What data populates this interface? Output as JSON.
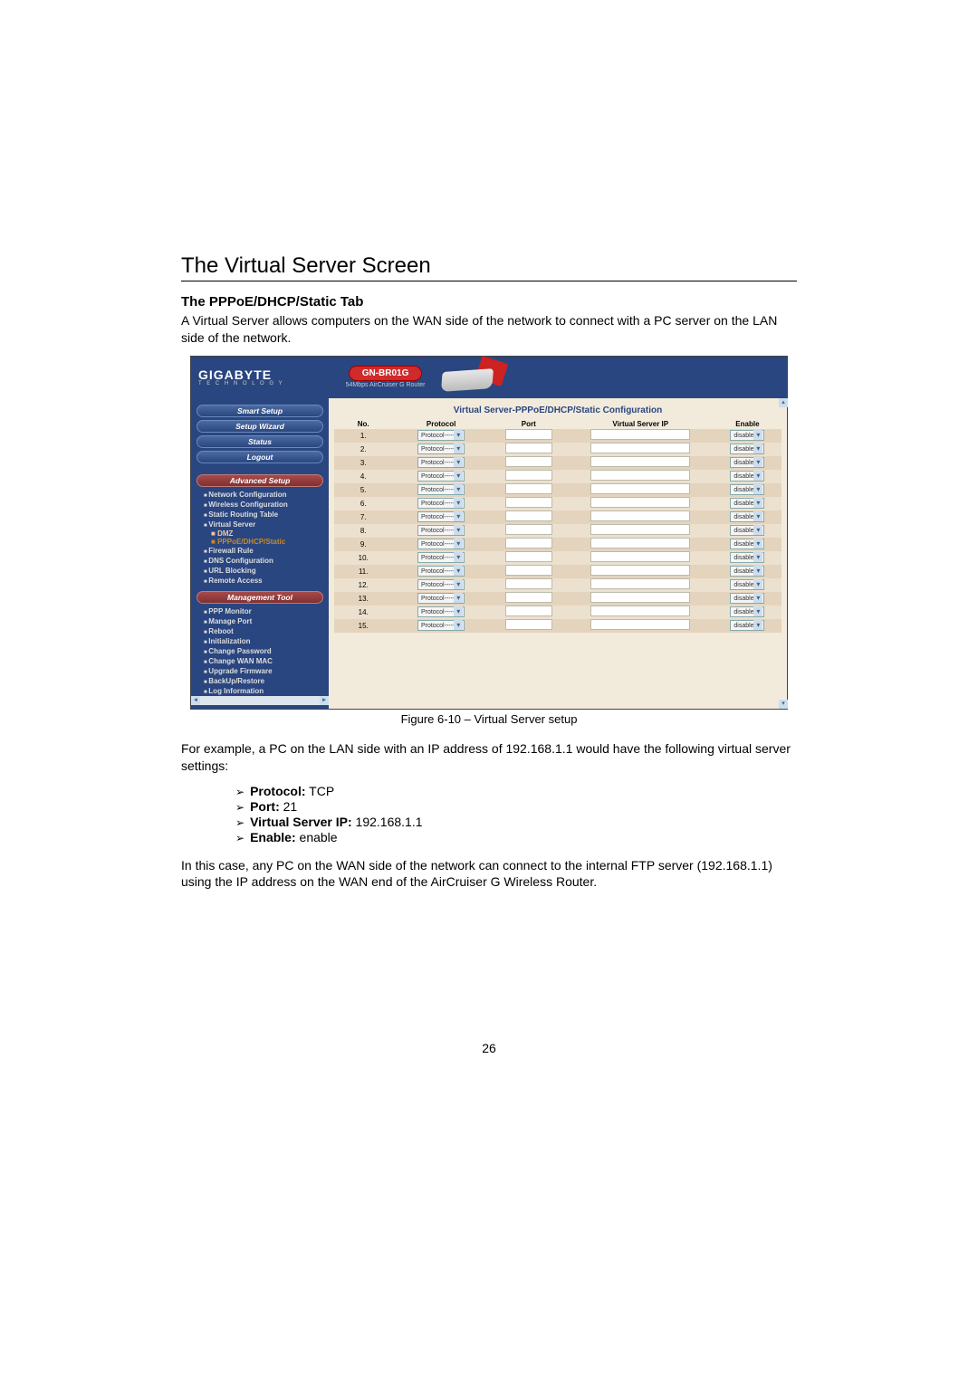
{
  "title": "The Virtual Server Screen",
  "subtitle": "The PPPoE/DHCP/Static Tab",
  "intro": "A Virtual Server allows computers on the WAN side of the network to connect with a PC server on the LAN side of the network.",
  "fig": {
    "brand": "GIGABYTE",
    "brand_sub": "T E C H N O L O G Y",
    "model": "GN-BR01G",
    "model_sub": "54Mbps AirCruiser G Router",
    "smart_setup": "Smart Setup",
    "setup_wizard": "Setup Wizard",
    "status": "Status",
    "logout": "Logout",
    "advanced_setup": "Advanced Setup",
    "nav": {
      "net_cfg": "Network Configuration",
      "wls_cfg": "Wireless Configuration",
      "static_route": "Static Routing Table",
      "vserver": "Virtual Server",
      "dmz": "DMZ",
      "ppp_static": "PPPoE/DHCP/Static",
      "firewall": "Firewall Rule",
      "dns": "DNS Configuration",
      "url_block": "URL Blocking",
      "remote": "Remote Access"
    },
    "mgmt_tool": "Management Tool",
    "mgmt": {
      "ppp_monitor": "PPP Monitor",
      "manage_port": "Manage Port",
      "reboot": "Reboot",
      "init": "Initialization",
      "change_pw": "Change Password",
      "change_mac": "Change WAN MAC",
      "upgrade": "Upgrade Firmware",
      "backup": "BackUp/Restore",
      "log": "Log Information"
    },
    "content_title": "Virtual Server-PPPoE/DHCP/Static Configuration",
    "th_no": "No.",
    "th_protocol": "Protocol",
    "th_port": "Port",
    "th_vsip": "Virtual Server IP",
    "th_enable": "Enable",
    "protocol_opt": "Protocol-----",
    "enable_opt": "disable",
    "rows": [
      "1.",
      "2.",
      "3.",
      "4.",
      "5.",
      "6.",
      "7.",
      "8.",
      "9.",
      "10.",
      "11.",
      "12.",
      "13.",
      "14.",
      "15."
    ]
  },
  "caption": "Figure 6-10 – Virtual Server setup",
  "example_intro": "For example, a PC on the LAN side with an IP address of 192.168.1.1 would have the following virtual server settings:",
  "example": {
    "protocol_label": "Protocol:",
    "protocol_val": " TCP",
    "port_label": "Port:",
    "port_val": " 21",
    "vsip_label": "Virtual Server IP:",
    "vsip_val": " 192.168.1.1",
    "enable_label": "Enable:",
    "enable_val": " enable"
  },
  "conclusion": "In this case, any PC on the WAN side of the network can connect to the internal FTP server (192.168.1.1) using the IP address on the WAN end of the AirCruiser G Wireless Router.",
  "page_number": "26"
}
